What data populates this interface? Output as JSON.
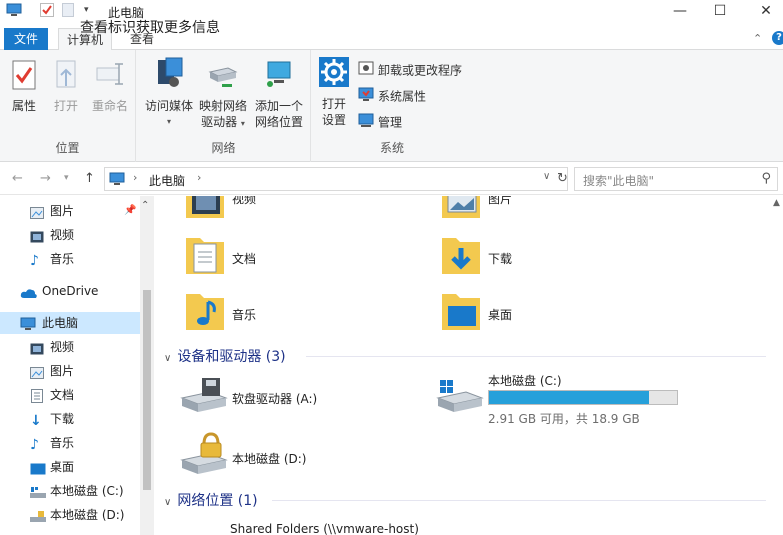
{
  "window": {
    "title": "此电脑",
    "minimize": "—",
    "maximize": "☐",
    "close": "✕"
  },
  "tabs": {
    "file": "文件",
    "computer": "计算机",
    "view": "查看",
    "tooltip": "查看标识获取更多信息",
    "help": "?"
  },
  "ribbon": {
    "location_group": "位置",
    "network_group": "网络",
    "system_group": "系统",
    "properties": "属性",
    "open": "打开",
    "rename": "重命名",
    "access_media": "访问媒体",
    "map_drive_l1": "映射网络",
    "map_drive_l2": "驱动器",
    "add_netloc_l1": "添加一个",
    "add_netloc_l2": "网络位置",
    "open_settings_l1": "打开",
    "open_settings_l2": "设置",
    "uninstall": "卸载或更改程序",
    "sys_props": "系统属性",
    "manage": "管理"
  },
  "address": {
    "path": "此电脑",
    "search_placeholder": "搜索\"此电脑\""
  },
  "nav": {
    "items": [
      {
        "label": "图片"
      },
      {
        "label": "视频"
      },
      {
        "label": "音乐"
      },
      {
        "label": "OneDrive"
      },
      {
        "label": "此电脑"
      },
      {
        "label": "视频"
      },
      {
        "label": "图片"
      },
      {
        "label": "文档"
      },
      {
        "label": "下载"
      },
      {
        "label": "音乐"
      },
      {
        "label": "桌面"
      },
      {
        "label": "本地磁盘 (C:)"
      },
      {
        "label": "本地磁盘 (D:)"
      }
    ]
  },
  "folders": {
    "videos": "视频",
    "pictures": "图片",
    "documents": "文档",
    "downloads": "下载",
    "music": "音乐",
    "desktop": "桌面"
  },
  "devices": {
    "header": "设备和驱动器 (3)",
    "floppy": "软盘驱动器 (A:)",
    "c_drive": "本地磁盘 (C:)",
    "c_usage": "2.91 GB 可用，共 18.9 GB",
    "c_fill_fraction": 0.85,
    "d_drive": "本地磁盘 (D:)"
  },
  "network": {
    "header": "网络位置 (1)",
    "item": "Shared Folders (\\\\vmware-host)"
  },
  "colors": {
    "accent": "#1979ca",
    "selection": "#cce8ff",
    "bar_fill": "#26a0da",
    "section_header": "#1e3287"
  }
}
